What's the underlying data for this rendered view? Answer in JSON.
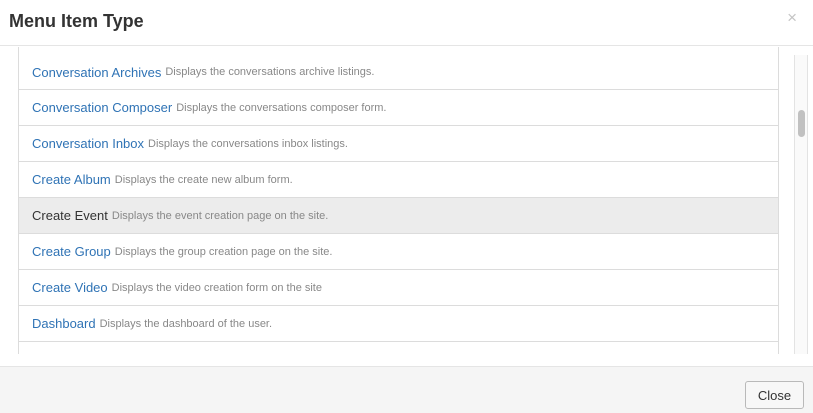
{
  "header": {
    "title": "Menu Item Type",
    "close_glyph": "×"
  },
  "items": [
    {
      "title": "Conversation Archives",
      "desc": "Displays the conversations archive listings."
    },
    {
      "title": "Conversation Composer",
      "desc": "Displays the conversations composer form."
    },
    {
      "title": "Conversation Inbox",
      "desc": "Displays the conversations inbox listings."
    },
    {
      "title": "Create Album",
      "desc": "Displays the create new album form."
    },
    {
      "title": "Create Event",
      "desc": "Displays the event creation page on the site.",
      "selected": true
    },
    {
      "title": "Create Group",
      "desc": "Displays the group creation page on the site."
    },
    {
      "title": "Create Video",
      "desc": "Displays the video creation form on the site"
    },
    {
      "title": "Dashboard",
      "desc": "Displays the dashboard of the user."
    },
    {
      "title": "",
      "desc": ""
    }
  ],
  "footer": {
    "close_label": "Close"
  },
  "colors": {
    "link": "#2f73b5",
    "selected_bg": "#ececec"
  }
}
